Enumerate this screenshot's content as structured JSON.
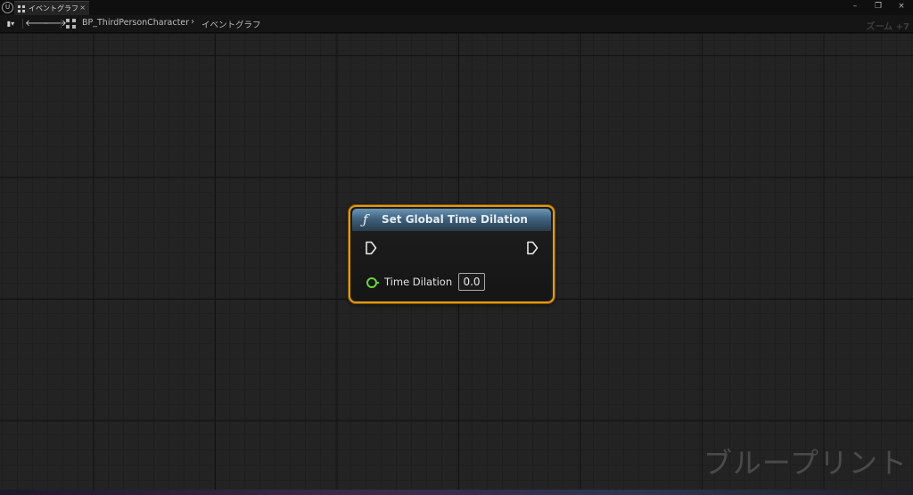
{
  "app": {
    "logo_text": "U",
    "tab": {
      "label": "イベントグラフ",
      "close": "×"
    },
    "window_controls": {
      "minimize": "–",
      "restore": "❐",
      "close": "×"
    }
  },
  "toolbar": {
    "menu_glyph": "▮▾",
    "back": "🡐",
    "forward": "🡒",
    "breadcrumb": {
      "root": "BP_ThirdPersonCharacter",
      "separator": "›",
      "current": "イベントグラフ"
    },
    "zoom": "ズーム +7"
  },
  "node": {
    "icon": "ƒ",
    "title": "Set Global Time Dilation",
    "input_pin": {
      "label": "Time Dilation",
      "value": "0.0"
    },
    "colors": {
      "border": "#e39a12",
      "header": "#40627e",
      "float_pin": "#6bd33a"
    }
  },
  "canvas": {
    "watermark": "ブループリント"
  }
}
